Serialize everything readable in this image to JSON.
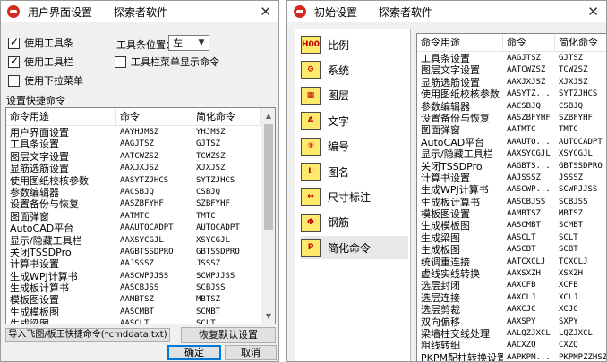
{
  "left_dialog": {
    "title": "用户界面设置——探索者软件",
    "close_glyph": "✕",
    "options": {
      "use_toolbar": {
        "label": "使用工具条",
        "checked": true
      },
      "use_toolbar2": {
        "label": "使用工具栏",
        "checked": true
      },
      "use_dropdown": {
        "label": "使用下拉菜单",
        "checked": false
      },
      "toolbar_menu": {
        "label": "工具栏菜单显示命令",
        "checked": false
      },
      "toolbar_pos_label": "工具条位置：",
      "toolbar_pos_value": "左"
    },
    "section_label": "设置快捷命令",
    "columns": [
      "命令用途",
      "命令",
      "简化命令"
    ],
    "rows": [
      [
        "用户界面设置",
        "AAYHJMSZ",
        "YHJMSZ"
      ],
      [
        "工具条设置",
        "AAGJTSZ",
        "GJTSZ"
      ],
      [
        "图层文字设置",
        "AATCWZSZ",
        "TCWZSZ"
      ],
      [
        "显筋选筋设置",
        "AAXJXJSZ",
        "XJXJSZ"
      ],
      [
        "使用图纸校核参数",
        "AASYTZJHCS",
        "SYTZJHCS"
      ],
      [
        "参数编辑器",
        "AACSBJQ",
        "CSBJQ"
      ],
      [
        "设置备份与恢复",
        "AASZBFYHF",
        "SZBFYHF"
      ],
      [
        "图面弹窗",
        "AATMTC",
        "TMTC"
      ],
      [
        "AutoCAD平台",
        "AAAUTOCADPT",
        "AUTOCADPT"
      ],
      [
        "显示/隐藏工具栏",
        "AAXSYCGJL",
        "XSYCGJL"
      ],
      [
        "关闭TSSDPro",
        "AAGBTSSDPRO",
        "GBTSSDPRO"
      ],
      [
        "计算书设置",
        "AAJSSSZ",
        "JSSSZ"
      ],
      [
        "生成WPJ计算书",
        "AASCWPJJSS",
        "SCWPJJSS"
      ],
      [
        "生成板计算书",
        "AASCBJSS",
        "SCBJSS"
      ],
      [
        "模板图设置",
        "AAMBTSZ",
        "MBTSZ"
      ],
      [
        "生成模板图",
        "AASCMBT",
        "SCMBT"
      ],
      [
        "生成梁图",
        "AASCLT",
        "SCLT"
      ]
    ],
    "import_button": "导入飞图/板王快捷命令(*cmddata.txt)",
    "restore_button": "恢复默认设置",
    "ok_button": "确定",
    "cancel_button": "取消"
  },
  "right_dialog": {
    "title": "初始设置——探索者软件",
    "close_glyph": "✕",
    "nav": [
      {
        "label": "比例",
        "icon": "H00",
        "icon_name": "scale-icon"
      },
      {
        "label": "系统",
        "icon": "⚙",
        "icon_name": "system-icon"
      },
      {
        "label": "图层",
        "icon": "▦",
        "icon_name": "layer-icon"
      },
      {
        "label": "文字",
        "icon": "A",
        "icon_name": "text-icon"
      },
      {
        "label": "编号",
        "icon": "①",
        "icon_name": "numbering-icon"
      },
      {
        "label": "图名",
        "icon": "L",
        "icon_name": "drawing-name-icon"
      },
      {
        "label": "尺寸标注",
        "icon": "↔",
        "icon_name": "dimension-icon"
      },
      {
        "label": "钢筋",
        "icon": "Φ",
        "icon_name": "rebar-icon"
      },
      {
        "label": "简化命令",
        "icon": "P",
        "icon_name": "shortcut-command-icon"
      }
    ],
    "selected_nav": 8,
    "columns": [
      "命令用途",
      "命令",
      "简化命令"
    ],
    "rows": [
      [
        "工具条设置",
        "AAGJTSZ",
        "GJTSZ"
      ],
      [
        "图层文字设置",
        "AATCWZSZ",
        "TCWZSZ"
      ],
      [
        "显筋选筋设置",
        "AAXJXJSZ",
        "XJXJSZ"
      ],
      [
        "使用图纸校核参数",
        "AASYTZ...",
        "SYTZJHCS"
      ],
      [
        "参数编辑器",
        "AACSBJQ",
        "CSBJQ"
      ],
      [
        "设置备份与恢复",
        "AASZBFYHF",
        "SZBFYHF"
      ],
      [
        "图面弹窗",
        "AATMTC",
        "TMTC"
      ],
      [
        "AutoCAD平台",
        "AAAUTO...",
        "AUTOCADPT"
      ],
      [
        "显示/隐藏工具栏",
        "AAXSYCGJL",
        "XSYCGJL"
      ],
      [
        "关闭TSSDPro",
        "AAGBTS...",
        "GBTSSDPRO"
      ],
      [
        "计算书设置",
        "AAJSSSZ",
        "JSSSZ"
      ],
      [
        "生成WPJ计算书",
        "AASCWP...",
        "SCWPJJSS"
      ],
      [
        "生成板计算书",
        "AASCBJSS",
        "SCBJSS"
      ],
      [
        "模板图设置",
        "AAMBTSZ",
        "MBTSZ"
      ],
      [
        "生成模板图",
        "AASCMBT",
        "SCMBT"
      ],
      [
        "生成梁图",
        "AASCLT",
        "SCLT"
      ],
      [
        "生成板图",
        "AASCBT",
        "SCBT"
      ],
      [
        "统调重连接",
        "AATCXCLJ",
        "TCXCLJ"
      ],
      [
        "虚线实线转换",
        "AAXSXZH",
        "XSXZH"
      ],
      [
        "选层封闭",
        "AAXCFB",
        "XCFB"
      ],
      [
        "选层连接",
        "AAXCLJ",
        "XCLJ"
      ],
      [
        "选层剪裁",
        "AAXCJC",
        "XCJC"
      ],
      [
        "双向偏移",
        "AAXSPY",
        "SXPY"
      ],
      [
        "梁墙柱交线处理",
        "AALQZJXCL",
        "LQZJXCL"
      ],
      [
        "粗线转细",
        "AACXZQ",
        "CXZQ"
      ],
      [
        "PKPM配柱转换设置",
        "AAPKPM...",
        "PKPMPZZHSZ"
      ]
    ]
  }
}
